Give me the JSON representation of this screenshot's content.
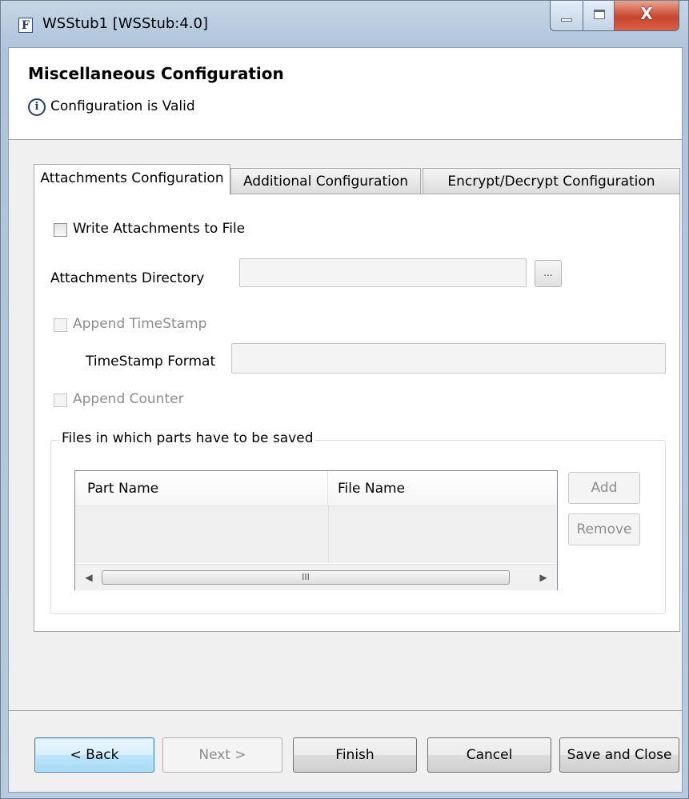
{
  "window": {
    "title": "WSStub1 [WSStub:4.0]",
    "icon_letter": "F",
    "close_glyph": "X"
  },
  "header": {
    "title": "Miscellaneous Configuration",
    "status": "Configuration is Valid",
    "status_icon": "i"
  },
  "tabs": [
    {
      "label": "Attachments Configuration",
      "active": true
    },
    {
      "label": "Additional Configuration",
      "active": false
    },
    {
      "label": "Encrypt/Decrypt Configuration",
      "active": false
    }
  ],
  "form": {
    "write_attachments_label": "Write Attachments to File",
    "write_attachments_checked": false,
    "attachments_directory_label": "Attachments Directory",
    "attachments_directory_value": "",
    "browse_label": "...",
    "append_timestamp_label": "Append TimeStamp",
    "timestamp_format_label": "TimeStamp Format",
    "timestamp_format_value": "",
    "append_counter_label": "Append Counter"
  },
  "parts_group": {
    "legend": "Files in which parts have to be saved",
    "columns": [
      "Part Name",
      "File Name"
    ],
    "rows": [],
    "scroll_left": "◀",
    "scroll_right": "▶",
    "thumb_grip": "III",
    "add_label": "Add",
    "remove_label": "Remove"
  },
  "footer": {
    "back": "< Back",
    "next": "Next >",
    "finish": "Finish",
    "cancel": "Cancel",
    "save_close": "Save and Close"
  }
}
